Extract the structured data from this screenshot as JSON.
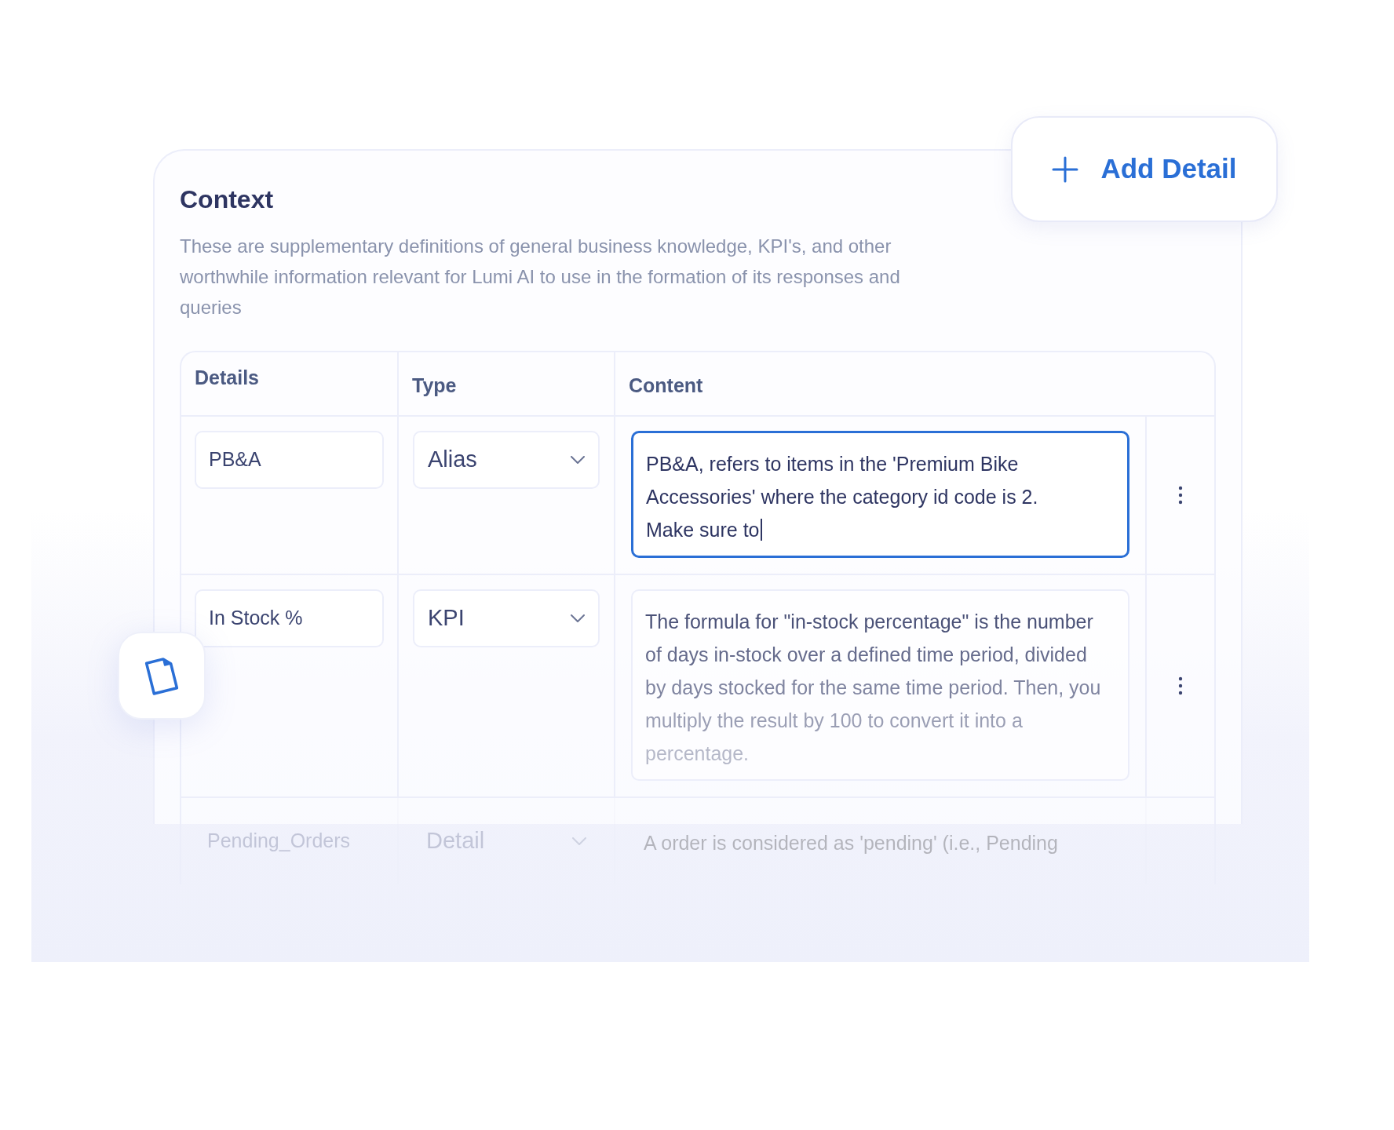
{
  "add_button": {
    "label": "Add Detail"
  },
  "context": {
    "title": "Context",
    "description": "These are supplementary definitions of general business knowledge, KPI's, and other worthwhile information relevant for Lumi AI to use in the formation of its responses and queries"
  },
  "table": {
    "columns": [
      "Details",
      "Type",
      "Content"
    ],
    "rows": [
      {
        "detail": "PB&A",
        "type": "Alias",
        "content": [
          "PB&A, refers to items in the 'Premium Bike",
          "Accessories' where the category id code is 2.",
          "Make sure to"
        ],
        "focused": true,
        "faded": false
      },
      {
        "detail": "In Stock %",
        "type": "KPI",
        "content": [
          "The formula for \"in-stock percentage\" is the number",
          "of days in-stock over a defined time period, divided",
          "by days stocked for the same time period. Then, you",
          "multiply the result by 100 to convert it into a",
          "percentage."
        ],
        "focused": false,
        "faded": false
      },
      {
        "detail": "Pending_Orders",
        "type": "Detail",
        "content": [
          "A order is considered as 'pending' (i.e., Pending"
        ],
        "focused": false,
        "faded": true
      }
    ]
  }
}
